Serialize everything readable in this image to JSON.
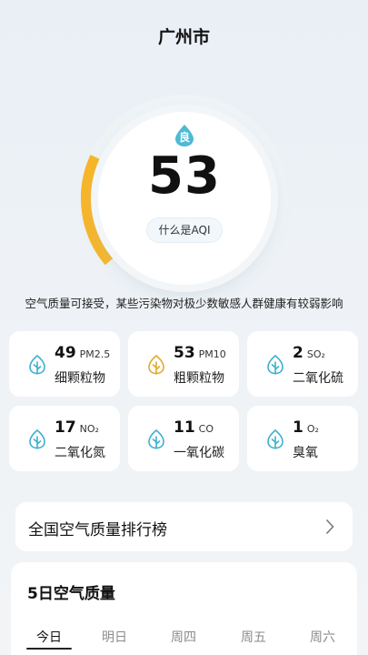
{
  "header": {
    "city": "广州市"
  },
  "aqi": {
    "value": "53",
    "level": "良",
    "level_fraction": 0.18,
    "link_label": "什么是AQI",
    "description": "空气质量可接受，某些污染物对极少数敏感人群健康有较弱影响",
    "arc_color": "#f8b526",
    "badge_color": "#4fb9d6"
  },
  "pollutants": [
    {
      "value": "49",
      "code": "PM2.5",
      "name": "细颗粒物",
      "icon": "leaf-icon",
      "color": "#3cb0cf"
    },
    {
      "value": "53",
      "code": "PM10",
      "name": "粗颗粒物",
      "icon": "leaf-icon",
      "color": "#e0aa2a"
    },
    {
      "value": "2",
      "code": "SO₂",
      "name": "二氧化硫",
      "icon": "leaf-icon",
      "color": "#3cb0cf"
    },
    {
      "value": "17",
      "code": "NO₂",
      "name": "二氧化氮",
      "icon": "leaf-icon",
      "color": "#3cb0cf"
    },
    {
      "value": "11",
      "code": "CO",
      "name": "一氧化碳",
      "icon": "leaf-icon",
      "color": "#3cb0cf"
    },
    {
      "value": "1",
      "code": "O₂",
      "name": "臭氧",
      "icon": "leaf-icon",
      "color": "#3cb0cf"
    }
  ],
  "ranking": {
    "label": "全国空气质量排行榜",
    "icon": "chevron-right-icon"
  },
  "forecast": {
    "title": "5日空气质量",
    "days": [
      "今日",
      "明日",
      "周四",
      "周五",
      "周六"
    ],
    "selected": "今日"
  }
}
